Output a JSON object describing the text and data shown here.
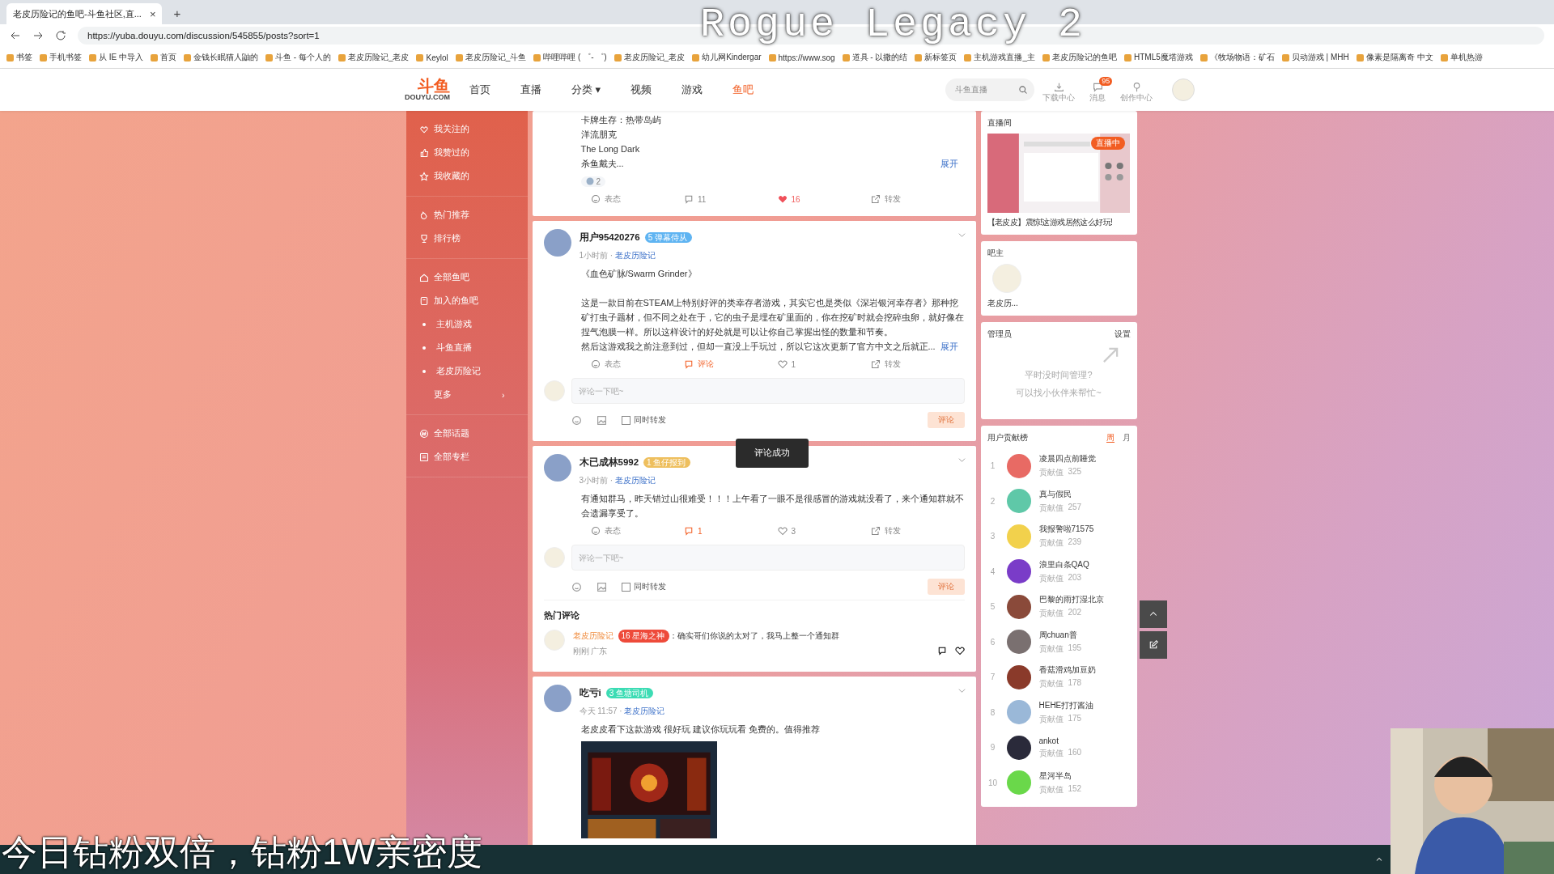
{
  "browser": {
    "tabs": [
      {
        "title": "老皮历险记的鱼吧-斗鱼社区,直...",
        "selected": true,
        "close": "×"
      }
    ],
    "new_tab": "+",
    "url": "https://yuba.douyu.com/discussion/545855/posts?sort=1",
    "bookmarks": [
      "书签",
      "手机书签",
      "从 IE 中导入",
      "首页",
      "金钱长眠猫人鼬的",
      "斗鱼 - 每个人的",
      "老皮历险记_老皮",
      "Keylol",
      "老皮历险记_斗鱼",
      "哔哩哔哩 ( ゜- ゜)",
      "老皮历险记_老皮",
      "幼儿网Kindergar",
      "https://www.sog",
      "道具 - 以撒的结",
      "新标签页",
      "主机游戏直播_主",
      "老皮历险记的鱼吧",
      "HTML5魔塔游戏",
      "《牧场物语：矿石",
      "贝动游戏 | MHH",
      "像素是隔离奇 中文",
      "单机热游"
    ]
  },
  "overlays": {
    "title": "Rogue Legacy 2",
    "banner": "今日钻粉双倍，钻粉1W亲密度"
  },
  "header": {
    "logo": "斗鱼",
    "logo_sub": "DOUYU.COM",
    "nav": [
      {
        "label": "首页",
        "selected": false
      },
      {
        "label": "直播",
        "selected": false
      },
      {
        "label": "分类",
        "selected": false,
        "dropdown": "▾"
      },
      {
        "label": "视频",
        "selected": false
      },
      {
        "label": "游戏",
        "selected": false
      },
      {
        "label": "鱼吧",
        "selected": true
      }
    ],
    "search": {
      "placeholder": "斗鱼直播"
    },
    "tools": [
      {
        "kind": "download",
        "label": "下载中心"
      },
      {
        "kind": "message",
        "label": "消息",
        "badge": "95"
      },
      {
        "kind": "create",
        "label": "创作中心"
      }
    ]
  },
  "sidebar": {
    "groups": [
      [
        {
          "kind": "follow",
          "label": "我关注的"
        },
        {
          "kind": "like",
          "label": "我赞过的"
        },
        {
          "kind": "star",
          "label": "我收藏的"
        }
      ],
      [
        {
          "kind": "hot",
          "label": "热门推荐"
        },
        {
          "kind": "trophy",
          "label": "排行榜"
        }
      ],
      [
        {
          "kind": "home",
          "label": "全部鱼吧"
        },
        {
          "kind": "joined",
          "label": "加入的鱼吧"
        },
        {
          "kind": "dot",
          "label": "主机游戏"
        },
        {
          "kind": "dot",
          "label": "斗鱼直播"
        },
        {
          "kind": "dot",
          "label": "老皮历险记"
        },
        {
          "kind": "more",
          "label": "更多",
          "arrow": "›"
        }
      ],
      [
        {
          "kind": "topic",
          "label": "全部话题"
        },
        {
          "kind": "column",
          "label": "全部专栏"
        }
      ]
    ]
  },
  "posts": [
    {
      "paragraphs": [
        [
          "卡牌生存：热带岛屿",
          "洋流朋克",
          "The Long Dark",
          "杀鱼戴夫..."
        ]
      ],
      "expand": "展开",
      "reaction_count": "2",
      "actions": [
        {
          "kind": "react",
          "label": "表态",
          "active": false
        },
        {
          "kind": "comment",
          "label": "11",
          "active": false
        },
        {
          "kind": "like",
          "label": "16",
          "active": true
        },
        {
          "kind": "share",
          "label": "转发",
          "active": false
        }
      ]
    },
    {
      "user": "用户95420276",
      "badge": {
        "level": "5",
        "title": "弹幕侍从",
        "color": "#5fb4f2"
      },
      "time": "1小时前 · ",
      "bar": "老皮历险记",
      "paragraphs": [
        [
          "《血色矿脉/Swarm Grinder》"
        ],
        [
          "这是一款目前在STEAM上特别好评的类幸存者游戏，其实它也是类似《深岩银河幸存者》那种挖矿打虫子题材，但不同之处在于，它的虫子是埋在矿里面的，你在挖矿时就会挖碎虫卵，就好像在捏气泡膜一样。所以这样设计的好处就是可以让你自己掌握出怪的数量和节奏。",
          "然后这游戏我之前注意到过，但却一直没上手玩过，所以它这次更新了官方中文之后就正..."
        ]
      ],
      "expand": "展开",
      "actions": [
        {
          "kind": "react",
          "label": "表态",
          "active": false
        },
        {
          "kind": "comment",
          "label": "评论",
          "active": true
        },
        {
          "kind": "like",
          "label": "1",
          "active": false
        },
        {
          "kind": "share",
          "label": "转发",
          "active": false
        }
      ],
      "reply": {
        "placeholder": "评论一下吧~",
        "repost": "同时转发",
        "repost_checked": false,
        "submit": "评论"
      }
    },
    {
      "user": "木已成林5992",
      "badge": {
        "level": "1",
        "title": "鱼仔报到",
        "color": "#eebf5e"
      },
      "time": "3小时前 · ",
      "bar": "老皮历险记",
      "paragraphs": [
        [
          "有通知群马，昨天错过山很难受！！！上午看了一眼不是很感冒的游戏就没看了，来个通知群就不会遗漏享受了。"
        ]
      ],
      "actions": [
        {
          "kind": "react",
          "label": "表态",
          "active": false
        },
        {
          "kind": "comment",
          "label": "1",
          "active": true
        },
        {
          "kind": "like",
          "label": "3",
          "active": false
        },
        {
          "kind": "share",
          "label": "转发",
          "active": false
        }
      ],
      "reply": {
        "placeholder": "评论一下吧~",
        "repost": "同时转发",
        "repost_checked": false,
        "submit": "评论"
      },
      "hot_title": "热门评论",
      "hot": [
        {
          "user": "老皮历险记",
          "badge": {
            "level": "16",
            "title": "星海之神",
            "color": "#ee4a3a"
          },
          "text": "：确实哥们你说的太对了，我马上整一个通知群",
          "meta": "刚刚  广东"
        }
      ]
    },
    {
      "user": "吃亏i",
      "badge": {
        "level": "3",
        "title": "鱼塘司机",
        "color": "#3cdcb4"
      },
      "time": "今天 11:57 · ",
      "bar": "老皮历险记",
      "paragraphs": [
        [
          "老皮皮看下这款游戏 很好玩 建议你玩玩看  免费的。值得推荐"
        ]
      ],
      "image": {
        "kind": "picture"
      }
    }
  ],
  "toast": "评论成功",
  "right": {
    "live": {
      "title": "直播间",
      "badge": "直播中",
      "caption": "【老皮皮】震惊!这游戏居然这么好玩!"
    },
    "owner": {
      "title": "吧主",
      "name": "老皮历..."
    },
    "admins": {
      "title": "管理员",
      "action": "设置",
      "hint": [
        "平时没时间管理?",
        "可以找小伙伴来帮忙~"
      ]
    },
    "ranking": {
      "title": "用户贡献榜",
      "tabs": [
        {
          "label": "周",
          "selected": true
        },
        {
          "label": "月",
          "selected": false
        }
      ],
      "rows": [
        {
          "rank": "1",
          "name": "凌晨四点前睡觉",
          "score_label": "贡献值",
          "score": "325",
          "color": "#e86a64"
        },
        {
          "rank": "2",
          "name": "真与假民",
          "score_label": "贡献值",
          "score": "257",
          "color": "#5fc8a8"
        },
        {
          "rank": "3",
          "name": "我报警啦71575",
          "score_label": "贡献值",
          "score": "239",
          "color": "#f2d14c"
        },
        {
          "rank": "4",
          "name": "浪里白条QAQ",
          "score_label": "贡献值",
          "score": "203",
          "color": "#7a3cc8"
        },
        {
          "rank": "5",
          "name": "巴黎的雨打湿北京",
          "score_label": "贡献值",
          "score": "202",
          "color": "#8a4a3a"
        },
        {
          "rank": "6",
          "name": "周chuan普",
          "score_label": "贡献值",
          "score": "195",
          "color": "#7a7070"
        },
        {
          "rank": "7",
          "name": "香菇滑鸡加豆奶",
          "score_label": "贡献值",
          "score": "178",
          "color": "#8a3a2a"
        },
        {
          "rank": "8",
          "name": "HEHE打打酱油",
          "score_label": "贡献值",
          "score": "175",
          "color": "#9ab8d8"
        },
        {
          "rank": "9",
          "name": "ankot",
          "score_label": "贡献值",
          "score": "160",
          "color": "#2a2a3a"
        },
        {
          "rank": "10",
          "name": "星河半岛",
          "score_label": "贡献值",
          "score": "152",
          "color": "#6ad84a"
        }
      ]
    }
  }
}
